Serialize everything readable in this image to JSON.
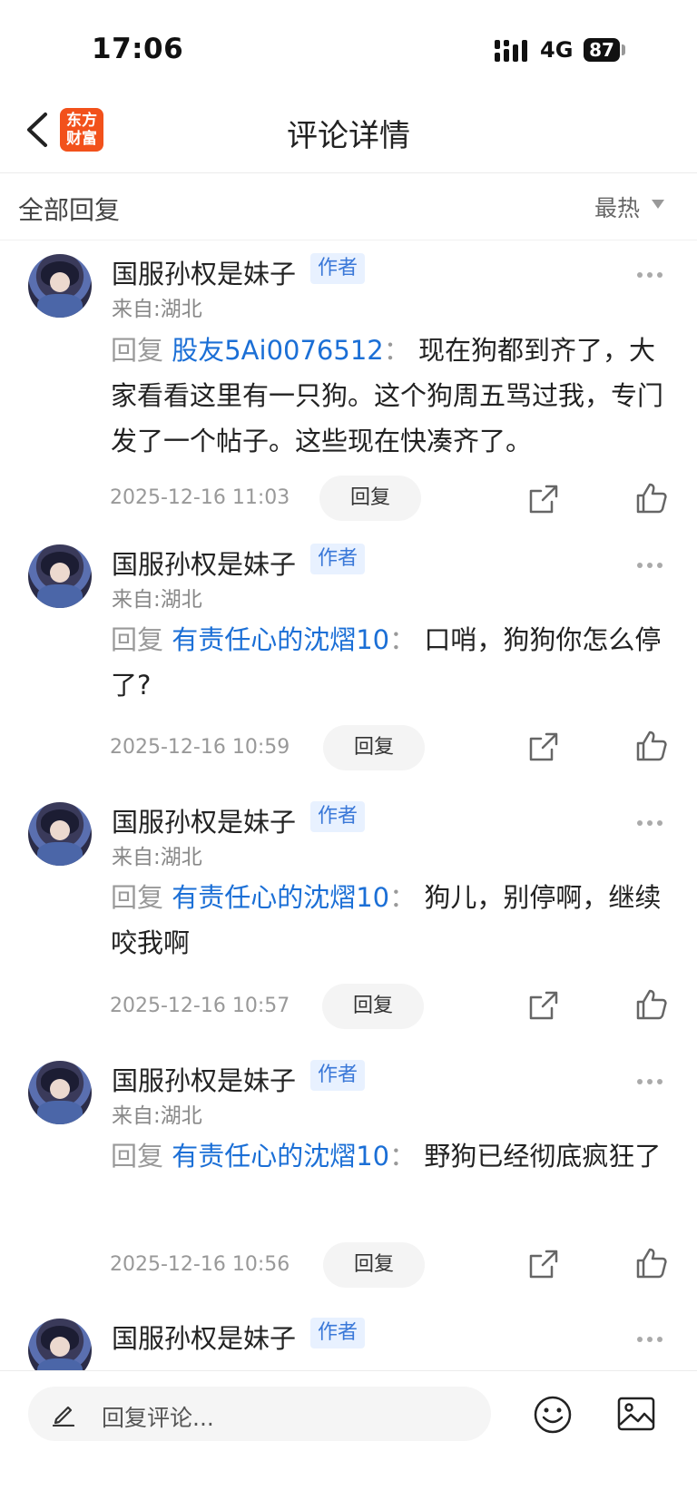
{
  "status_bar": {
    "time": "17:06",
    "network": "4G",
    "battery": "87"
  },
  "nav": {
    "title": "评论详情",
    "logo_text": "东方财富"
  },
  "filter": {
    "all_replies": "全部回复",
    "sort": "最热"
  },
  "comments": [
    {
      "user": "国服孙权是妹子",
      "author_tag": "作者",
      "location": "来自:湖北",
      "reply_word": "回复",
      "mention": "股友5Ai0076512",
      "colon": "：",
      "text": "现在狗都到齐了，大家看看这里有一只狗。这个狗周五骂过我，专门发了一个帖子。这些现在快凑齐了。",
      "date": "2025-12-16 11:03",
      "reply_label": "回复"
    },
    {
      "user": "国服孙权是妹子",
      "author_tag": "作者",
      "location": "来自:湖北",
      "reply_word": "回复",
      "mention": "有责任心的沈熠10",
      "colon": "：",
      "text": "口哨，狗狗你怎么停了?",
      "date": "2025-12-16 10:59",
      "reply_label": "回复"
    },
    {
      "user": "国服孙权是妹子",
      "author_tag": "作者",
      "location": "来自:湖北",
      "reply_word": "回复",
      "mention": "有责任心的沈熠10",
      "colon": "：",
      "text": "狗儿，别停啊，继续咬我啊",
      "date": "2025-12-16 10:57",
      "reply_label": "回复"
    },
    {
      "user": "国服孙权是妹子",
      "author_tag": "作者",
      "location": "来自:湖北",
      "reply_word": "回复",
      "mention": "有责任心的沈熠10",
      "colon": "：",
      "text": "野狗已经彻底疯狂了",
      "date": "2025-12-16 10:56",
      "reply_label": "回复"
    },
    {
      "user": "国服孙权是妹子",
      "author_tag": "作者"
    }
  ],
  "bottom_bar": {
    "placeholder": "回复评论..."
  },
  "icons": {
    "back": "back-icon",
    "more": "more-icon",
    "share": "share-icon",
    "like": "thumbs-up-icon",
    "pencil": "pencil-icon",
    "emoji": "emoji-icon",
    "image": "image-icon"
  },
  "colors": {
    "brand": "#f2511b",
    "mention": "#1b6fd6",
    "author_tag_bg": "#e8f1ff"
  }
}
